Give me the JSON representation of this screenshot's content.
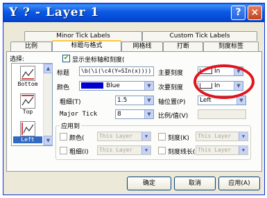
{
  "window": {
    "title": "Y ? - Layer 1",
    "help_btn": "?",
    "close_btn": "×"
  },
  "tabs_top": [
    "Minor Tick Labels",
    "Custom Tick Labels"
  ],
  "tabs_bottom": [
    "比例",
    "标题与格式",
    "网格线",
    "打断",
    "刻度标签"
  ],
  "selection": {
    "label": "选择:",
    "items": [
      "Bottom",
      "Top",
      "Left"
    ],
    "active": "Left"
  },
  "show_axis": {
    "label": "显示坐标轴和刻度(",
    "checked": true
  },
  "title_field": {
    "label": "标题",
    "value": "\\b(\\i(\\c4(Y=SIn(x))))"
  },
  "color_field": {
    "label": "颜色",
    "value": "Blue",
    "swatch": "#0000cc"
  },
  "thickness": {
    "label": "粗细(T)",
    "value": "1.5"
  },
  "major_tick": {
    "label": "Major Tick",
    "value": "8"
  },
  "major_ticks": {
    "label": "主要刻度"
  },
  "minor_ticks": {
    "label": "次要刻度"
  },
  "tick_value": "In",
  "axis_position": {
    "label": "轴位置(P)",
    "value": "Left"
  },
  "ratio": {
    "label": "比例/值(V)"
  },
  "apply_to": {
    "title": "应用到",
    "rows": [
      {
        "left": "颜色(",
        "right": "刻度(K)",
        "scope": "This Layer"
      },
      {
        "left": "粗细(I)",
        "right": "刻度线长(",
        "scope": "This Layer"
      }
    ]
  },
  "buttons": {
    "ok": "确定",
    "cancel": "取消",
    "apply": "应用(A)"
  },
  "colors": {
    "title_bar": "#0b5ae3",
    "highlight_ring": "#e0141e",
    "selection": "#316ac5"
  }
}
